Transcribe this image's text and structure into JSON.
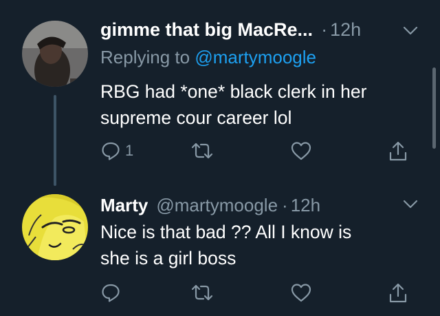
{
  "tweets": [
    {
      "display_name": "gimme that big MacRe...",
      "separator": "·",
      "time": "12h",
      "reply_prefix": "Replying to ",
      "reply_to": "@martymoogle",
      "text_line1": "RBG had *one* black clerk in her",
      "text_line2": "supreme cour career lol",
      "reply_count": "1"
    },
    {
      "display_name": "Marty",
      "handle": "@martymoogle",
      "separator": "·",
      "time": "12h",
      "text_line1": "Nice is that bad ?? All I know is",
      "text_line2": "she is a girl boss"
    }
  ],
  "icons": {
    "reply": "reply-icon",
    "retweet": "retweet-icon",
    "like": "heart-icon",
    "share": "share-icon",
    "more": "chevron-down-icon"
  },
  "colors": {
    "background": "#15202b",
    "text": "#ffffff",
    "muted": "#8899a6",
    "link": "#1da1f2"
  }
}
